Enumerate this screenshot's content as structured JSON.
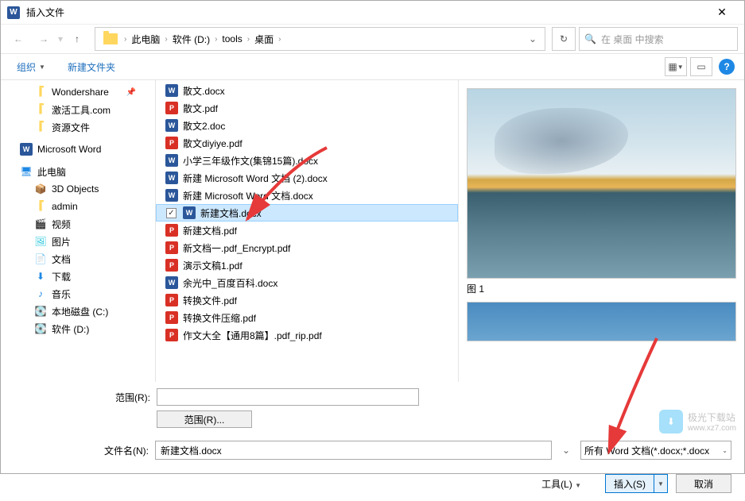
{
  "window": {
    "title": "插入文件"
  },
  "breadcrumb": {
    "pc": "此电脑",
    "drive": "软件 (D:)",
    "folder1": "tools",
    "folder2": "桌面"
  },
  "search": {
    "placeholder": "在 桌面 中搜索"
  },
  "toolbar": {
    "organize": "组织",
    "newfolder": "新建文件夹"
  },
  "sidebar": {
    "wondershare": "Wondershare",
    "activate": "激活工具.com",
    "resources": "资源文件",
    "msword": "Microsoft Word",
    "thispc": "此电脑",
    "objects3d": "3D Objects",
    "admin": "admin",
    "videos": "视频",
    "pictures": "图片",
    "documents": "文档",
    "downloads": "下载",
    "music": "音乐",
    "localdisk": "本地磁盘 (C:)",
    "drive_d": "软件 (D:)"
  },
  "files": {
    "f0": "散文.docx",
    "f1": "散文.pdf",
    "f2": "散文2.doc",
    "f3": "散文diyiye.pdf",
    "f4": "小学三年级作文(集锦15篇).docx",
    "f5": "新建 Microsoft Word 文档 (2).docx",
    "f6": "新建 Microsoft Word 文档.docx",
    "f7": "新建文档.docx",
    "f8": "新建文档.pdf",
    "f9": "新文档一.pdf_Encrypt.pdf",
    "f10": "演示文稿1.pdf",
    "f11": "余光中_百度百科.docx",
    "f12": "转换文件.pdf",
    "f13": "转换文件压缩.pdf",
    "f14": "作文大全【通用8篇】.pdf_rip.pdf"
  },
  "preview": {
    "label1": "图 1"
  },
  "bottom": {
    "range_label": "范围(R):",
    "range_btn": "范围(R)...",
    "filename_label": "文件名(N):",
    "filename_value": "新建文档.docx",
    "filter": "所有 Word 文档(*.docx;*.docx",
    "tools": "工具(L)",
    "insert": "插入(S)",
    "cancel": "取消"
  },
  "watermark": {
    "text": "极光下载站",
    "url": "www.xz7.com"
  }
}
